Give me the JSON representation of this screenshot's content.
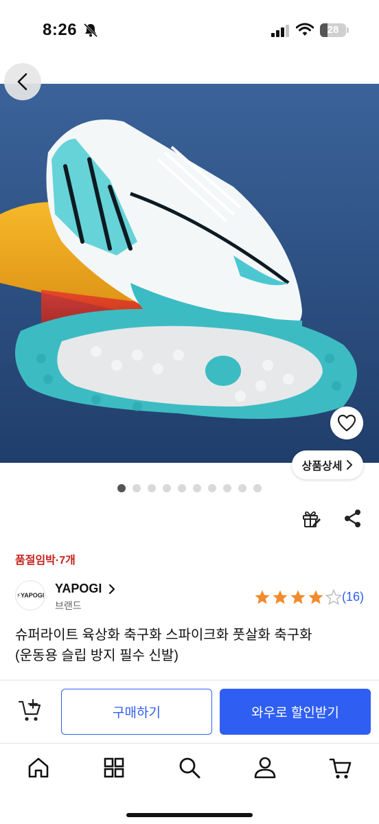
{
  "status_bar": {
    "time": "8:26",
    "battery": "28",
    "battery_level": 0.28
  },
  "hero": {
    "image_desc_icon": "product-image",
    "detail_button_label": "상품상세",
    "dots_total": 10,
    "dots_active_index": 0
  },
  "product": {
    "stock_notice": "품절임박·7개",
    "brand_logo_text": "⚡YAPOGI",
    "brand_name": "YAPOGI",
    "brand_sub": "브랜드",
    "rating": 4,
    "rating_max": 5,
    "review_count": "(16)",
    "title_line1": "슈퍼라이트 육상화 축구화 스파이크화 풋살화 축구화",
    "title_line2": "(운동용 슬립 방지 필수 신발)"
  },
  "purchase": {
    "buy_label": "구매하기",
    "wow_label": "와우로 할인받기"
  },
  "nav": {
    "items": [
      "home-icon",
      "category-icon",
      "search-icon",
      "user-icon",
      "cart-icon"
    ]
  },
  "colors": {
    "accent": "#2f5ef2",
    "star": "#f28b2c",
    "alert": "#c7211b"
  }
}
